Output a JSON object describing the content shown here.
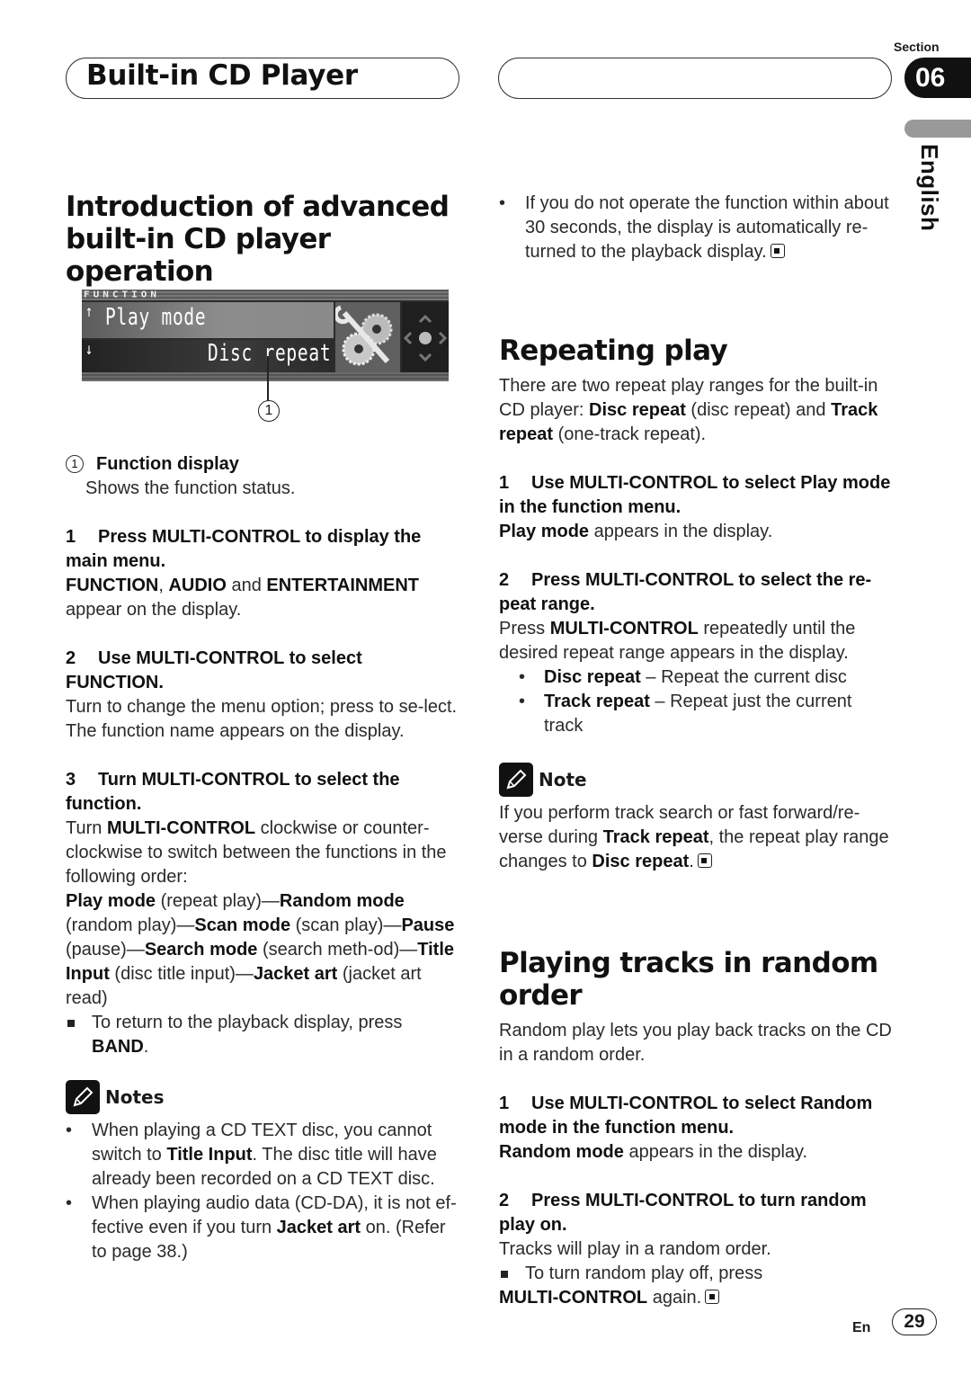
{
  "header": {
    "chapter_title": "Built-in CD Player",
    "section_label": "Section",
    "section_number": "06",
    "language": "English"
  },
  "left": {
    "heading": "Introduction of advanced built-in CD player operation",
    "display": {
      "func_label": "FUNCTION",
      "line1": "Play mode",
      "line2": "Disc repeat",
      "callout": "1",
      "icon": "wrench-gears-icon"
    },
    "legend": {
      "num": "1",
      "title": "Function display",
      "desc": "Shows the function status."
    },
    "step1": {
      "num": "1",
      "title": "Press MULTI-CONTROL to display the main menu.",
      "b1": "FUNCTION",
      "t1": ", ",
      "b2": "AUDIO",
      "t2": " and ",
      "b3": "ENTERTAINMENT",
      "t3": "appear on the display."
    },
    "step2": {
      "num": "2",
      "title": "Use MULTI-CONTROL to select FUNCTION.",
      "p1": "Turn to change the menu option; press to se-lect.",
      "p2": "The function name appears on the display."
    },
    "step3": {
      "num": "3",
      "title": "Turn MULTI-CONTROL to select the function.",
      "p1_a": "Turn ",
      "p1_b": "MULTI-CONTROL",
      "p1_c": " clockwise or counter-clockwise to switch between the functions in the following order:",
      "order": [
        {
          "name": "Play mode",
          "desc": " (repeat play)—"
        },
        {
          "name": "Random mode",
          "desc": " (random play)—"
        },
        {
          "name": "Scan mode",
          "desc": " (scan play)—"
        },
        {
          "name": "Pause",
          "desc": " (pause)—"
        },
        {
          "name": "Search mode",
          "desc": " (search meth-od)—"
        },
        {
          "name": "Title Input",
          "desc": " (disc title input)—"
        },
        {
          "name": "Jacket art",
          "desc": " (jacket art read)"
        }
      ],
      "return_text": "To return to the playback display, press ",
      "return_key": "BAND",
      "return_end": "."
    },
    "notes": {
      "label": "Notes",
      "items": [
        {
          "a": "When playing a CD TEXT disc, you cannot switch to ",
          "b": "Title Input",
          "c": ". The disc title will have already been recorded on a CD TEXT disc."
        },
        {
          "a": "When playing audio data (CD-DA), it is not ef-fective even if you turn ",
          "b": "Jacket art",
          "c": " on. (Refer to page 38.)"
        }
      ]
    }
  },
  "right": {
    "top_bullet": "If you do not operate the function within about 30 seconds, the display is automatically re-turned to the playback display.",
    "repeat": {
      "heading": "Repeating play",
      "intro_a": "There are two repeat play ranges for the built-in CD player: ",
      "intro_b": "Disc repeat",
      "intro_c": " (disc repeat) and ",
      "intro_d": "Track repeat",
      "intro_e": " (one-track repeat).",
      "step1": {
        "num": "1",
        "title": "Use MULTI-CONTROL to select Play mode in the function menu.",
        "b": "Play mode",
        "t": " appears in the display."
      },
      "step2": {
        "num": "2",
        "title": "Press MULTI-CONTROL to select the re-peat range.",
        "p_a": "Press ",
        "p_b": "MULTI-CONTROL",
        "p_c": " repeatedly until the desired repeat range appears in the display.",
        "options": [
          {
            "name": "Disc repeat",
            "desc": " – Repeat the current disc"
          },
          {
            "name": "Track repeat",
            "desc": " – Repeat just the current track"
          }
        ]
      },
      "note": {
        "label": "Note",
        "a": "If you perform track search or fast forward/re-verse during ",
        "b": "Track repeat",
        "c": ", the repeat play range changes to ",
        "d": "Disc repeat",
        "e": "."
      }
    },
    "random": {
      "heading": "Playing tracks in random order",
      "intro": "Random play lets you play back tracks on the CD in a random order.",
      "step1": {
        "num": "1",
        "title": "Use MULTI-CONTROL to select Random mode in the function menu.",
        "b": "Random mode",
        "t": " appears in the display."
      },
      "step2": {
        "num": "2",
        "title": "Press MULTI-CONTROL to turn random play on.",
        "p": "Tracks will play in a random order.",
        "off_a": "To turn random play off, press",
        "off_b": "MULTI-CONTROL",
        "off_c": " again."
      }
    }
  },
  "footer": {
    "lang_code": "En",
    "page": "29"
  }
}
